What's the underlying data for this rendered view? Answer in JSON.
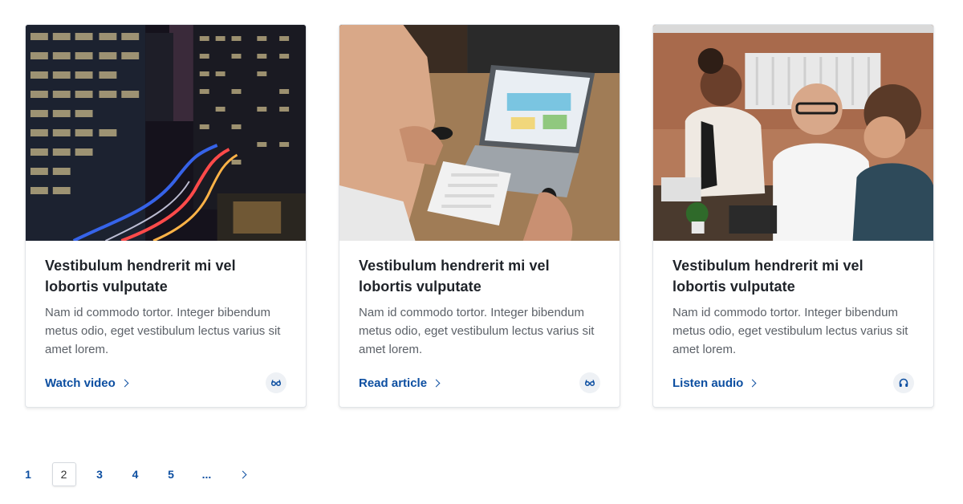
{
  "cards": [
    {
      "image": "city-night-light-trails",
      "title": "Vestibulum hendrerit mi vel lobortis vulputate",
      "description": "Nam id commodo tortor. Integer bibendum metus odio, eget vestibulum lectus varius sit amet lorem.",
      "link_label": "Watch video",
      "type_icon": "glasses-icon"
    },
    {
      "image": "laptop-desk-analytics",
      "title": "Vestibulum hendrerit mi vel lobortis vulputate",
      "description": "Nam id commodo tortor. Integer bibendum metus odio, eget vestibulum lectus varius sit amet lorem.",
      "link_label": "Read article",
      "type_icon": "glasses-icon"
    },
    {
      "image": "team-meeting-table",
      "title": "Vestibulum hendrerit mi vel lobortis vulputate",
      "description": "Nam id commodo tortor. Integer bibendum metus odio, eget vestibulum lectus varius sit amet lorem.",
      "link_label": "Listen audio",
      "type_icon": "headphones-icon"
    }
  ],
  "pagination": {
    "pages": [
      "1",
      "2",
      "3",
      "4",
      "5",
      "..."
    ],
    "current": "2",
    "next_icon": "chevron-right-icon"
  },
  "colors": {
    "link": "#0d4fa1",
    "title": "#1f2329",
    "body_text": "#5c6168",
    "badge_bg": "#eef1f5",
    "card_border": "#e1e4e8"
  }
}
